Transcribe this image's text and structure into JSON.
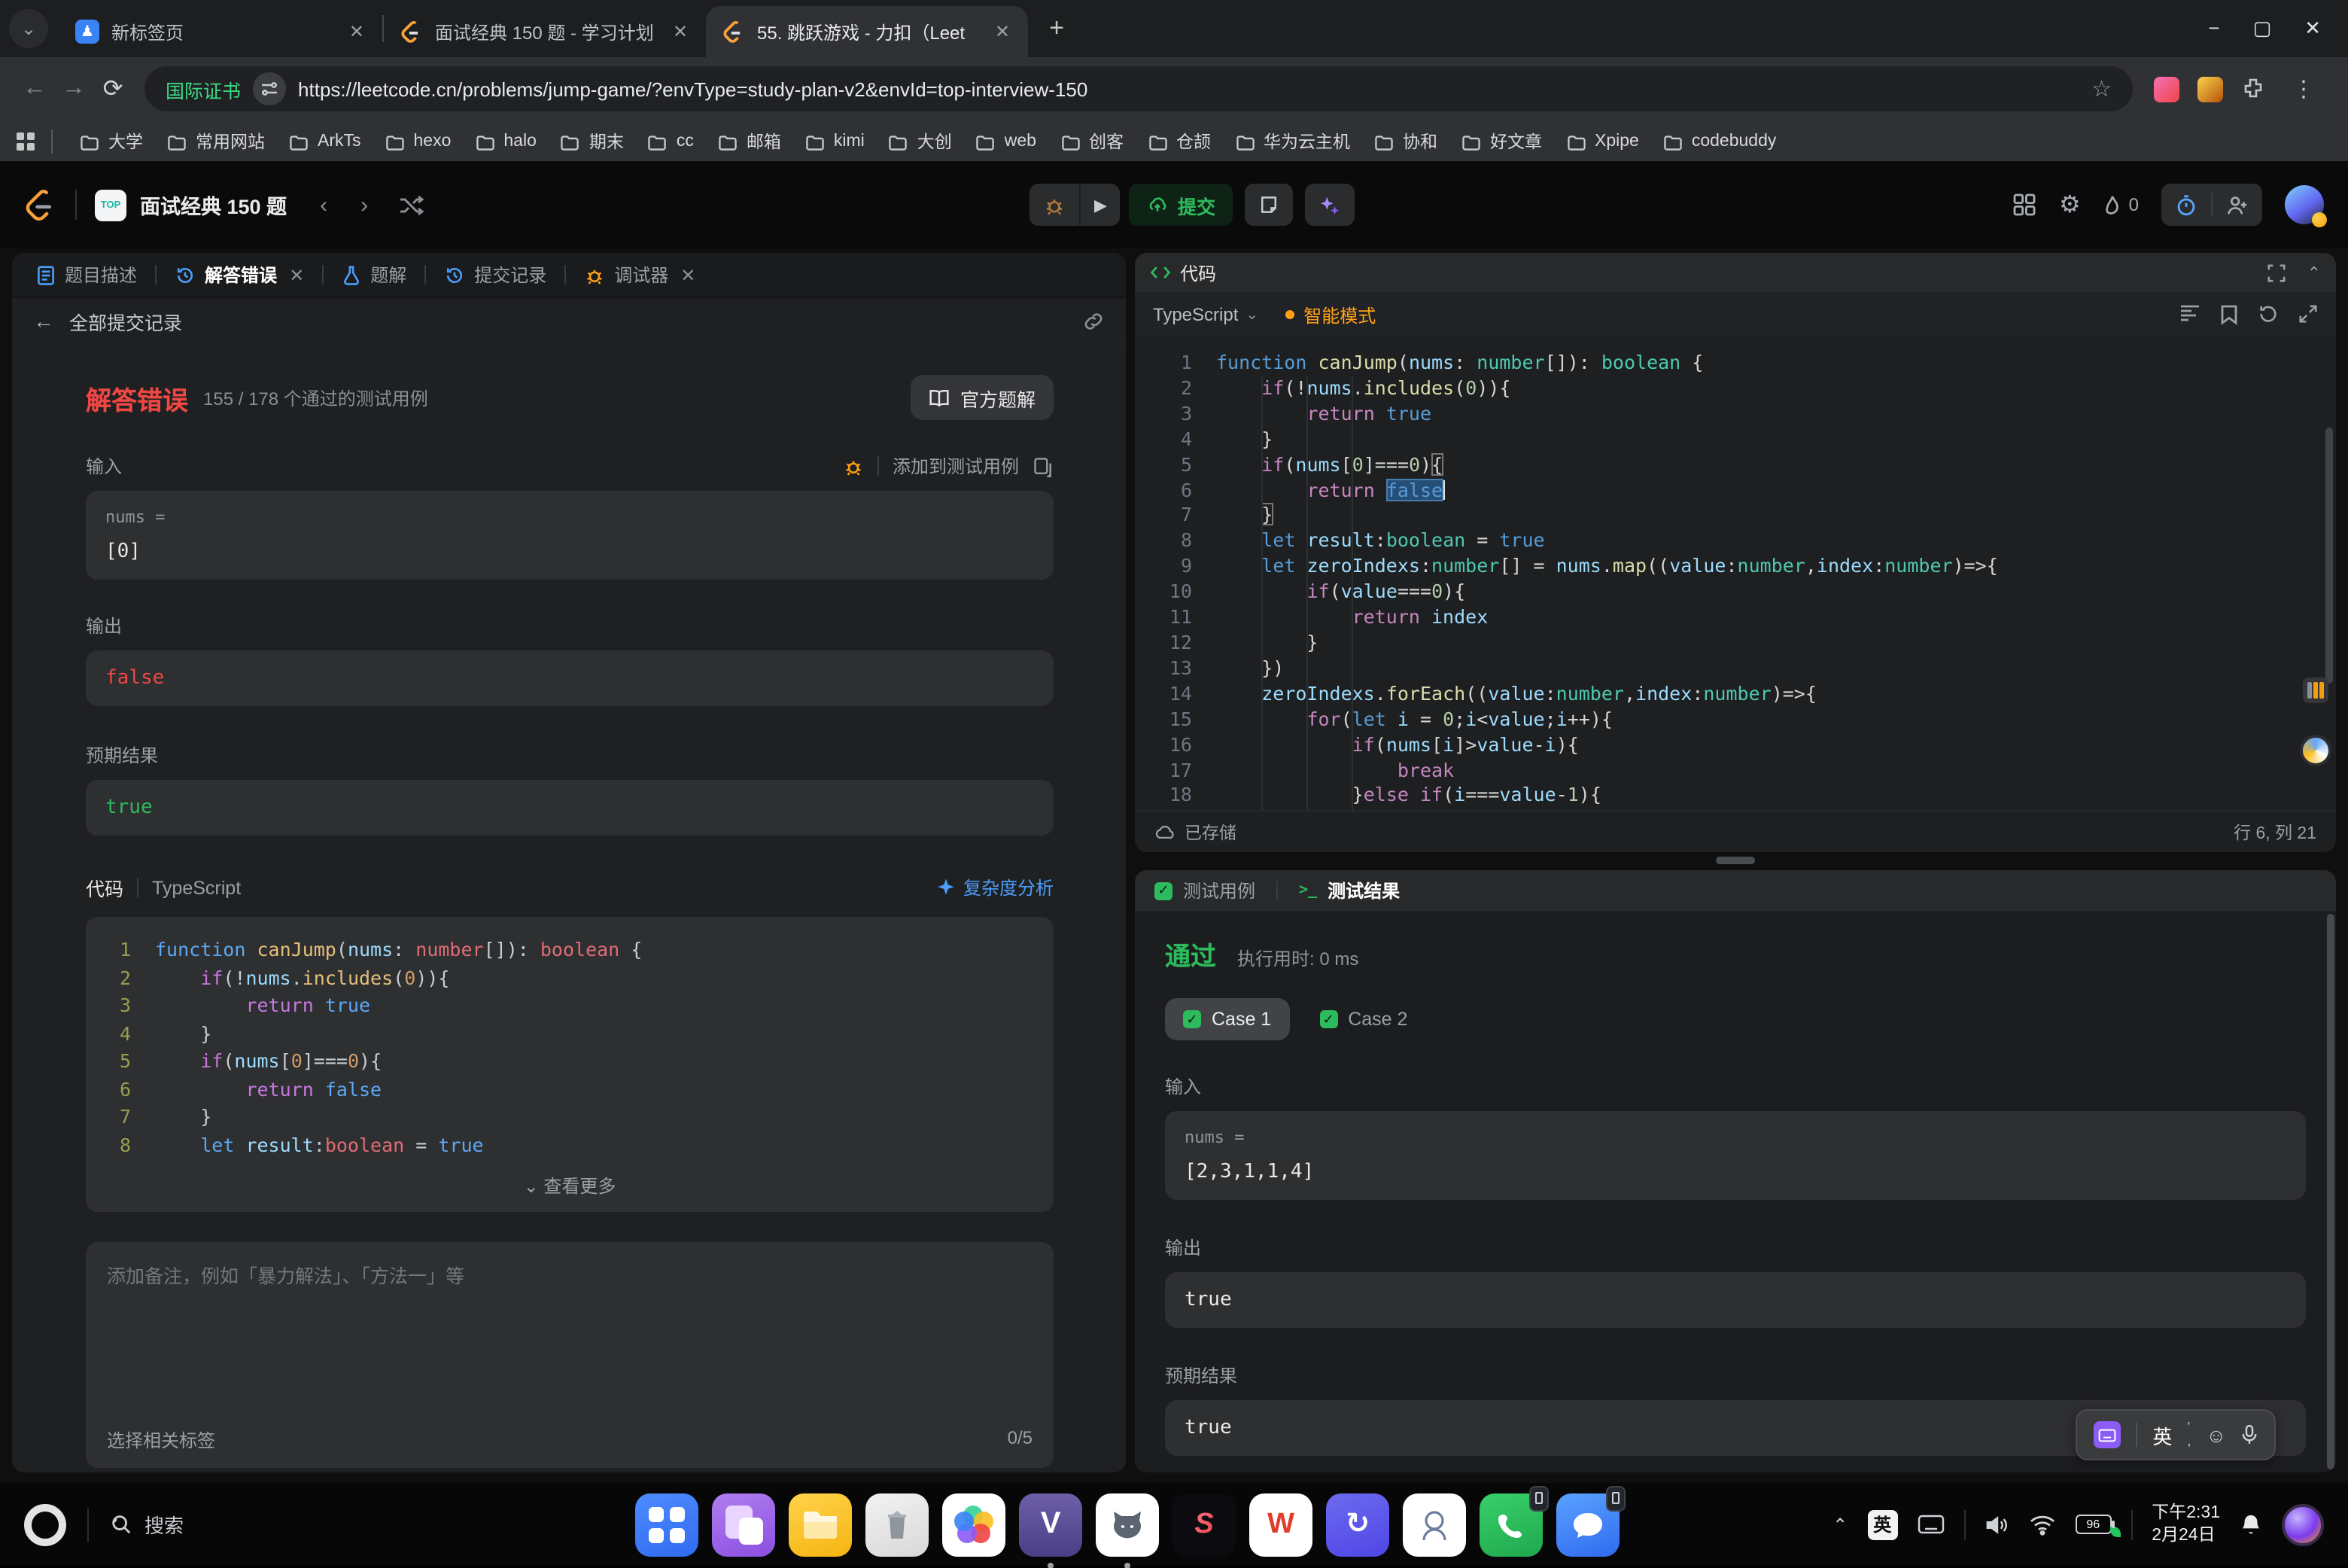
{
  "browser": {
    "tabs": [
      {
        "title": "新标签页",
        "favicon": "newtab-favicon",
        "active": false
      },
      {
        "title": "面试经典 150 题 - 学习计划",
        "favicon": "leetcode-favicon",
        "active": false
      },
      {
        "title": "55. 跳跃游戏 - 力扣（Leet",
        "favicon": "leetcode-favicon",
        "active": true
      }
    ],
    "cert_badge": "国际证书",
    "url": "https://leetcode.cn/problems/jump-game/?envType=study-plan-v2&envId=top-interview-150",
    "bookmarks": [
      "大学",
      "常用网站",
      "ArkTs",
      "hexo",
      "halo",
      "期末",
      "cc",
      "邮箱",
      "kimi",
      "大创",
      "web",
      "创客",
      "仓颉",
      "华为云主机",
      "协和",
      "好文章",
      "Xpipe",
      "codebuddy"
    ]
  },
  "nav": {
    "plan_badge": "TOP",
    "plan_title": "面试经典 150 题",
    "submit_label": "提交",
    "streak_count": "0"
  },
  "left_panel": {
    "tabs": [
      {
        "label": "题目描述",
        "icon": "document-icon",
        "closable": false,
        "active": false
      },
      {
        "label": "解答错误",
        "icon": "history-icon",
        "closable": true,
        "active": true
      },
      {
        "label": "题解",
        "icon": "flask-icon",
        "closable": false,
        "active": false
      },
      {
        "label": "提交记录",
        "icon": "history-icon",
        "closable": false,
        "active": false
      },
      {
        "label": "调试器",
        "icon": "bug-icon",
        "closable": true,
        "active": false
      }
    ],
    "back_label": "全部提交记录",
    "verdict": {
      "title": "解答错误",
      "stats": "155 / 178 个通过的测试用例",
      "official_solution": "官方题解"
    },
    "io": {
      "input_label": "输入",
      "add_to_tests": "添加到测试用例",
      "param": "nums =",
      "input_value": "[0]",
      "output_label": "输出",
      "output_value": "false",
      "expected_label": "预期结果",
      "expected_value": "true"
    },
    "code_header": {
      "label": "代码",
      "lang": "TypeScript",
      "complexity": "复杂度分析"
    },
    "show_more": "查看更多",
    "note_placeholder": "添加备注，例如「暴力解法」、「方法一」等",
    "tag_label": "选择相关标签",
    "tag_count": "0/5",
    "tag_colors": [
      "#eab308",
      "#3b82f6",
      "#22c55e",
      "#f43f5e",
      "#8b5cf6"
    ],
    "code_lines": [
      [
        [
          "kw",
          "function"
        ],
        [
          "pun",
          " "
        ],
        [
          "fn",
          "canJump"
        ],
        [
          "pun",
          "("
        ],
        [
          "var",
          "nums"
        ],
        [
          "pun",
          ": "
        ],
        [
          "type",
          "number"
        ],
        [
          "pun",
          "[]): "
        ],
        [
          "type",
          "boolean"
        ],
        [
          "pun",
          " {"
        ]
      ],
      [
        [
          "pun",
          "    "
        ],
        [
          "ctl",
          "if"
        ],
        [
          "pun",
          "(!"
        ],
        [
          "var",
          "nums"
        ],
        [
          "pun",
          "."
        ],
        [
          "fn",
          "includes"
        ],
        [
          "pun",
          "("
        ],
        [
          "num",
          "0"
        ],
        [
          "pun",
          ")){"
        ]
      ],
      [
        [
          "pun",
          "        "
        ],
        [
          "ctl",
          "return"
        ],
        [
          "pun",
          " "
        ],
        [
          "lit",
          "true"
        ]
      ],
      [
        [
          "pun",
          "    }"
        ]
      ],
      [
        [
          "pun",
          "    "
        ],
        [
          "ctl",
          "if"
        ],
        [
          "pun",
          "("
        ],
        [
          "var",
          "nums"
        ],
        [
          "pun",
          "["
        ],
        [
          "num",
          "0"
        ],
        [
          "pun",
          "]==="
        ],
        [
          "num",
          "0"
        ],
        [
          "pun",
          "){"
        ]
      ],
      [
        [
          "pun",
          "        "
        ],
        [
          "ctl",
          "return"
        ],
        [
          "pun",
          " "
        ],
        [
          "lit",
          "false"
        ]
      ],
      [
        [
          "pun",
          "    }"
        ]
      ],
      [
        [
          "pun",
          "    "
        ],
        [
          "kw",
          "let"
        ],
        [
          "pun",
          " "
        ],
        [
          "var",
          "result"
        ],
        [
          "pun",
          ":"
        ],
        [
          "type",
          "boolean"
        ],
        [
          "pun",
          " = "
        ],
        [
          "lit",
          "true"
        ]
      ]
    ]
  },
  "editor": {
    "panel_title": "代码",
    "lang": "TypeScript",
    "mode": "智能模式",
    "saved": "已存储",
    "cursor_pos": "行 6, 列 21",
    "lines": [
      [
        [
          "kw",
          "function"
        ],
        [
          "pun",
          " "
        ],
        [
          "fn",
          "canJump"
        ],
        [
          "pun",
          "("
        ],
        [
          "var",
          "nums"
        ],
        [
          "pun",
          ": "
        ],
        [
          "type",
          "number"
        ],
        [
          "pun",
          "[]): "
        ],
        [
          "type",
          "boolean"
        ],
        [
          "pun",
          " {"
        ]
      ],
      [
        [
          "pun",
          "    "
        ],
        [
          "ctl",
          "if"
        ],
        [
          "pun",
          "(!"
        ],
        [
          "var",
          "nums"
        ],
        [
          "pun",
          "."
        ],
        [
          "fn",
          "includes"
        ],
        [
          "pun",
          "("
        ],
        [
          "num",
          "0"
        ],
        [
          "pun",
          ")){"
        ]
      ],
      [
        [
          "pun",
          "        "
        ],
        [
          "ctl",
          "return"
        ],
        [
          "pun",
          " "
        ],
        [
          "lit",
          "true"
        ]
      ],
      [
        [
          "pun",
          "    }"
        ]
      ],
      [
        [
          "pun",
          "    "
        ],
        [
          "ctl",
          "if"
        ],
        [
          "pun",
          "("
        ],
        [
          "var",
          "nums"
        ],
        [
          "pun",
          "["
        ],
        [
          "num",
          "0"
        ],
        [
          "pun",
          "]==="
        ],
        [
          "num",
          "0"
        ],
        [
          "pun",
          ")"
        ],
        [
          "brk",
          "{"
        ]
      ],
      [
        [
          "pun",
          "        "
        ],
        [
          "ctl",
          "return"
        ],
        [
          "pun",
          " "
        ],
        [
          "sel",
          "false"
        ],
        [
          "cur",
          ""
        ]
      ],
      [
        [
          "pun",
          "    "
        ],
        [
          "brk",
          "}"
        ]
      ],
      [
        [
          "pun",
          "    "
        ],
        [
          "kw",
          "let"
        ],
        [
          "pun",
          " "
        ],
        [
          "var",
          "result"
        ],
        [
          "pun",
          ":"
        ],
        [
          "type",
          "boolean"
        ],
        [
          "pun",
          " = "
        ],
        [
          "lit",
          "true"
        ]
      ],
      [
        [
          "pun",
          "    "
        ],
        [
          "kw",
          "let"
        ],
        [
          "pun",
          " "
        ],
        [
          "var",
          "zeroIndexs"
        ],
        [
          "pun",
          ":"
        ],
        [
          "type",
          "number"
        ],
        [
          "pun",
          "[] = "
        ],
        [
          "var",
          "nums"
        ],
        [
          "pun",
          "."
        ],
        [
          "fn",
          "map"
        ],
        [
          "pun",
          "(("
        ],
        [
          "var",
          "value"
        ],
        [
          "pun",
          ":"
        ],
        [
          "type",
          "number"
        ],
        [
          "pun",
          ","
        ],
        [
          "var",
          "index"
        ],
        [
          "pun",
          ":"
        ],
        [
          "type",
          "number"
        ],
        [
          "pun",
          ")=>{"
        ]
      ],
      [
        [
          "pun",
          "        "
        ],
        [
          "ctl",
          "if"
        ],
        [
          "pun",
          "("
        ],
        [
          "var",
          "value"
        ],
        [
          "pun",
          "==="
        ],
        [
          "num",
          "0"
        ],
        [
          "pun",
          "){"
        ]
      ],
      [
        [
          "pun",
          "            "
        ],
        [
          "ctl",
          "return"
        ],
        [
          "pun",
          " "
        ],
        [
          "var",
          "index"
        ]
      ],
      [
        [
          "pun",
          "        }"
        ]
      ],
      [
        [
          "pun",
          "    })"
        ]
      ],
      [
        [
          "pun",
          "    "
        ],
        [
          "var",
          "zeroIndexs"
        ],
        [
          "pun",
          "."
        ],
        [
          "fn",
          "forEach"
        ],
        [
          "pun",
          "(("
        ],
        [
          "var",
          "value"
        ],
        [
          "pun",
          ":"
        ],
        [
          "type",
          "number"
        ],
        [
          "pun",
          ","
        ],
        [
          "var",
          "index"
        ],
        [
          "pun",
          ":"
        ],
        [
          "type",
          "number"
        ],
        [
          "pun",
          ")=>{"
        ]
      ],
      [
        [
          "pun",
          "        "
        ],
        [
          "ctl",
          "for"
        ],
        [
          "pun",
          "("
        ],
        [
          "kw",
          "let"
        ],
        [
          "pun",
          " "
        ],
        [
          "var",
          "i"
        ],
        [
          "pun",
          " = "
        ],
        [
          "num",
          "0"
        ],
        [
          "pun",
          ";"
        ],
        [
          "var",
          "i"
        ],
        [
          "pun",
          "<"
        ],
        [
          "var",
          "value"
        ],
        [
          "pun",
          ";"
        ],
        [
          "var",
          "i"
        ],
        [
          "pun",
          "++){"
        ]
      ],
      [
        [
          "pun",
          "            "
        ],
        [
          "ctl",
          "if"
        ],
        [
          "pun",
          "("
        ],
        [
          "var",
          "nums"
        ],
        [
          "pun",
          "["
        ],
        [
          "var",
          "i"
        ],
        [
          "pun",
          "]>"
        ],
        [
          "var",
          "value"
        ],
        [
          "pun",
          "-"
        ],
        [
          "var",
          "i"
        ],
        [
          "pun",
          "){"
        ]
      ],
      [
        [
          "pun",
          "                "
        ],
        [
          "ctl",
          "break"
        ]
      ],
      [
        [
          "pun",
          "            }"
        ],
        [
          "ctl",
          "else"
        ],
        [
          "pun",
          " "
        ],
        [
          "ctl",
          "if"
        ],
        [
          "pun",
          "("
        ],
        [
          "var",
          "i"
        ],
        [
          "pun",
          "==="
        ],
        [
          "var",
          "value"
        ],
        [
          "pun",
          "-"
        ],
        [
          "num",
          "1"
        ],
        [
          "pun",
          "){"
        ]
      ]
    ]
  },
  "tests": {
    "tab_cases": "测试用例",
    "tab_result": "测试结果",
    "verdict": "通过",
    "runtime": "执行用时: 0 ms",
    "cases": [
      {
        "label": "Case 1",
        "active": true
      },
      {
        "label": "Case 2",
        "active": false
      }
    ],
    "input_label": "输入",
    "param": "nums =",
    "input_value": "[2,3,1,1,4]",
    "output_label": "输出",
    "output_value": "true",
    "expected_label": "预期结果",
    "expected_value": "true"
  },
  "ime": {
    "lang": "英"
  },
  "taskbar": {
    "search": "搜索",
    "tray_lang": "英",
    "battery": "96",
    "time": "下午2:31",
    "date": "2月24日",
    "apps": [
      {
        "name": "app-launcher-grid",
        "kind": "grid",
        "running": false,
        "badge": false
      },
      {
        "name": "app-window-manager",
        "kind": "windows",
        "running": false,
        "badge": false
      },
      {
        "name": "app-file-manager",
        "kind": "folder",
        "running": false,
        "badge": false
      },
      {
        "name": "app-trash",
        "kind": "trash",
        "running": false,
        "badge": false
      },
      {
        "name": "app-photos",
        "kind": "photos",
        "running": false,
        "badge": false
      },
      {
        "name": "app-v-tool",
        "kind": "vtool",
        "running": true,
        "badge": false
      },
      {
        "name": "app-cat-assistant",
        "kind": "cat",
        "running": true,
        "badge": false
      },
      {
        "name": "app-s-design",
        "kind": "slogo",
        "running": false,
        "badge": false
      },
      {
        "name": "app-wps",
        "kind": "wps",
        "running": false,
        "badge": false
      },
      {
        "name": "app-time-sync",
        "kind": "loop",
        "running": false,
        "badge": false
      },
      {
        "name": "app-astronaut",
        "kind": "astro",
        "running": false,
        "badge": false
      },
      {
        "name": "app-phone",
        "kind": "phone",
        "running": false,
        "badge": true
      },
      {
        "name": "app-messages",
        "kind": "chat",
        "running": false,
        "badge": true
      }
    ]
  }
}
